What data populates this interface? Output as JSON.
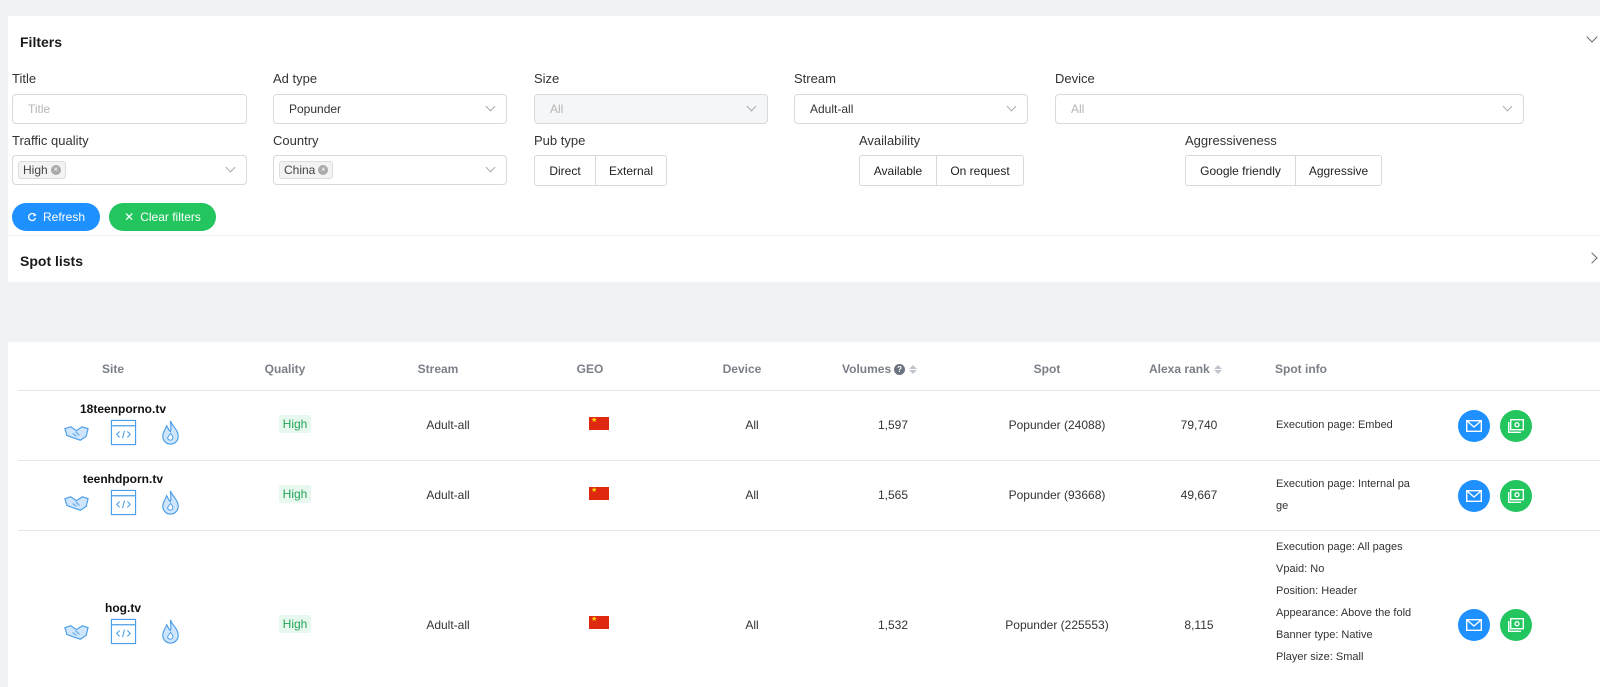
{
  "filters": {
    "title": "Filters",
    "fields": {
      "title": {
        "label": "Title",
        "placeholder": "Title"
      },
      "ad_type": {
        "label": "Ad type",
        "value": "Popunder"
      },
      "size": {
        "label": "Size",
        "value": "All"
      },
      "stream": {
        "label": "Stream",
        "value": "Adult-all"
      },
      "device": {
        "label": "Device",
        "value": "All"
      },
      "traffic_quality": {
        "label": "Traffic quality",
        "tag": "High"
      },
      "country": {
        "label": "Country",
        "tag": "China"
      },
      "pub_type": {
        "label": "Pub type",
        "options": [
          "Direct",
          "External"
        ]
      },
      "availability": {
        "label": "Availability",
        "options": [
          "Available",
          "On request"
        ]
      },
      "aggressiveness": {
        "label": "Aggressiveness",
        "options": [
          "Google friendly",
          "Aggressive"
        ]
      }
    },
    "refresh_label": "Refresh",
    "clear_label": "Clear filters"
  },
  "spot_lists": {
    "title": "Spot lists"
  },
  "table": {
    "headers": {
      "site": "Site",
      "quality": "Quality",
      "stream": "Stream",
      "geo": "GEO",
      "device": "Device",
      "volumes": "Volumes",
      "spot": "Spot",
      "alexa": "Alexa rank",
      "spot_info": "Spot info"
    },
    "rows": [
      {
        "site": "18teenporno.tv",
        "quality": "High",
        "stream": "Adult-all",
        "geo": "China",
        "device": "All",
        "volumes": "1,597",
        "spot": "Popunder (24088)",
        "alexa": "79,740",
        "info": [
          "Execution page: Embed"
        ]
      },
      {
        "site": "teenhdporn.tv",
        "quality": "High",
        "stream": "Adult-all",
        "geo": "China",
        "device": "All",
        "volumes": "1,565",
        "spot": "Popunder (93668)",
        "alexa": "49,667",
        "info": [
          "Execution page: Internal pa",
          "ge"
        ]
      },
      {
        "site": "hog.tv",
        "quality": "High",
        "stream": "Adult-all",
        "geo": "China",
        "device": "All",
        "volumes": "1,532",
        "spot": "Popunder (225553)",
        "alexa": "8,115",
        "info": [
          "Execution page: All pages",
          "Vpaid: No",
          "Position: Header",
          "Appearance: Above the fold",
          "Banner type: Native",
          "Player size: Small"
        ]
      }
    ]
  },
  "colors": {
    "primary": "#1e90ff",
    "success": "#22c55e",
    "quality_text": "#22a55a",
    "icon_blue": "#4a9eea"
  }
}
